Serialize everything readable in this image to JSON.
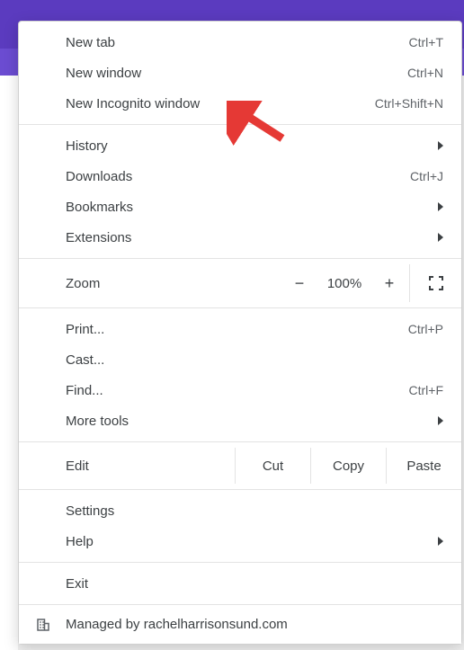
{
  "menu": {
    "newTab": {
      "label": "New tab",
      "shortcut": "Ctrl+T"
    },
    "newWindow": {
      "label": "New window",
      "shortcut": "Ctrl+N"
    },
    "newIncognito": {
      "label": "New Incognito window",
      "shortcut": "Ctrl+Shift+N"
    },
    "history": {
      "label": "History"
    },
    "downloads": {
      "label": "Downloads",
      "shortcut": "Ctrl+J"
    },
    "bookmarks": {
      "label": "Bookmarks"
    },
    "extensions": {
      "label": "Extensions"
    },
    "zoom": {
      "label": "Zoom",
      "minus": "−",
      "value": "100%",
      "plus": "+"
    },
    "print": {
      "label": "Print...",
      "shortcut": "Ctrl+P"
    },
    "cast": {
      "label": "Cast..."
    },
    "find": {
      "label": "Find...",
      "shortcut": "Ctrl+F"
    },
    "moreTools": {
      "label": "More tools"
    },
    "edit": {
      "label": "Edit",
      "cut": "Cut",
      "copy": "Copy",
      "paste": "Paste"
    },
    "settings": {
      "label": "Settings"
    },
    "help": {
      "label": "Help"
    },
    "exit": {
      "label": "Exit"
    },
    "managed": {
      "label": "Managed by rachelharrisonsund.com"
    }
  }
}
